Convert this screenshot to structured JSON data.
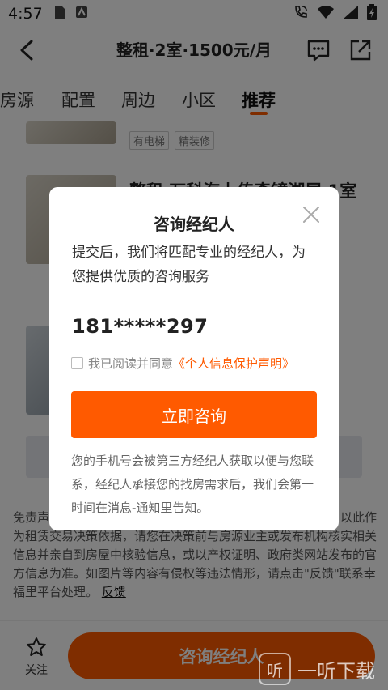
{
  "status_bar": {
    "time": "4:57"
  },
  "header": {
    "title": "整租·2室·1500元/月"
  },
  "tabs": [
    {
      "label": "房源"
    },
    {
      "label": "配置"
    },
    {
      "label": "周边"
    },
    {
      "label": "小区"
    },
    {
      "label": "推荐",
      "active": true
    }
  ],
  "listings": {
    "tags": [
      "有电梯",
      "精装修"
    ],
    "second_title": "整租 万科海上传奇镜湖居 1室"
  },
  "disclaimer": {
    "text": "免责声明：房源信息由第三方经纪人提供，仅供参考，切勿仅以此作为租赁交易决策依据，请您在决策前与房源业主或发布机构核实相关信息并亲自到房屋中核验信息，或以产权证明、政府类网站发布的官方信息为准。如图片等内容有侵权等违法情形，请点击\"反馈\"联系幸福里平台处理。",
    "feedback_link": "反馈"
  },
  "bottom_bar": {
    "follow_label": "关注",
    "consult_label": "咨询经纪人"
  },
  "modal": {
    "title": "咨询经纪人",
    "description": "提交后，我们将匹配专业的经纪人，为您提供优质的咨询服务",
    "phone": "181*****297",
    "agree_text": "我已阅读并同意",
    "agree_link": "《个人信息保护声明》",
    "submit_label": "立即咨询",
    "note": "您的手机号会被第三方经纪人获取以便与您联系，经纪人承接您的找房需求后，我们会第一时间在消息-通知里告知。"
  },
  "watermark": {
    "text": "一听下载"
  },
  "colors": {
    "accent": "#ff5a00",
    "overlay": "rgba(0,0,0,0.5)"
  }
}
